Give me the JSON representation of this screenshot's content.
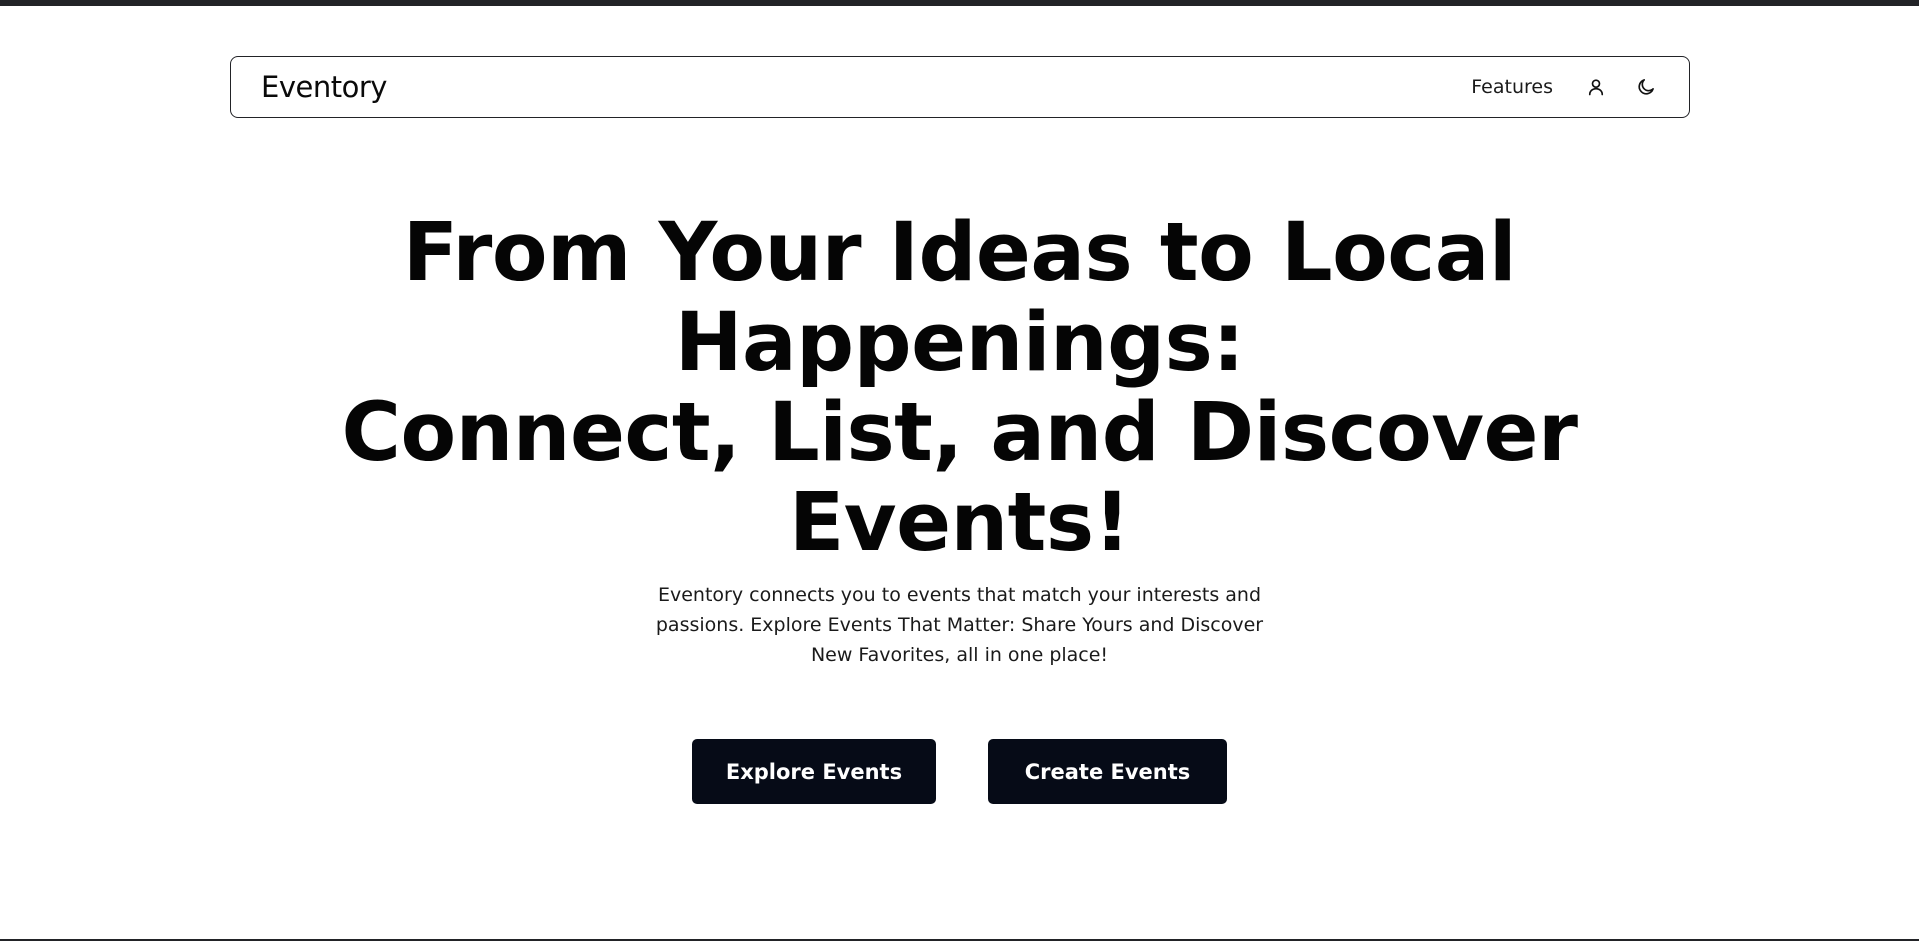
{
  "navbar": {
    "brand": "Eventory",
    "links": [
      {
        "label": "Features"
      }
    ],
    "icons": {
      "profile": "user-icon",
      "theme": "moon-icon"
    }
  },
  "hero": {
    "title_lines": [
      "From Your Ideas to Local",
      "Happenings:",
      "Connect, List, and Discover",
      "Events!"
    ],
    "subtitle": "Eventory connects you to events that match your interests and passions. Explore Events That Matter: Share Yours and Discover New Favorites, all in one place!"
  },
  "actions": {
    "explore_label": "Explore Events",
    "create_label": "Create Events"
  },
  "colors": {
    "accent_button": "#060b17",
    "text": "#0a0a0a",
    "border": "#222327"
  }
}
